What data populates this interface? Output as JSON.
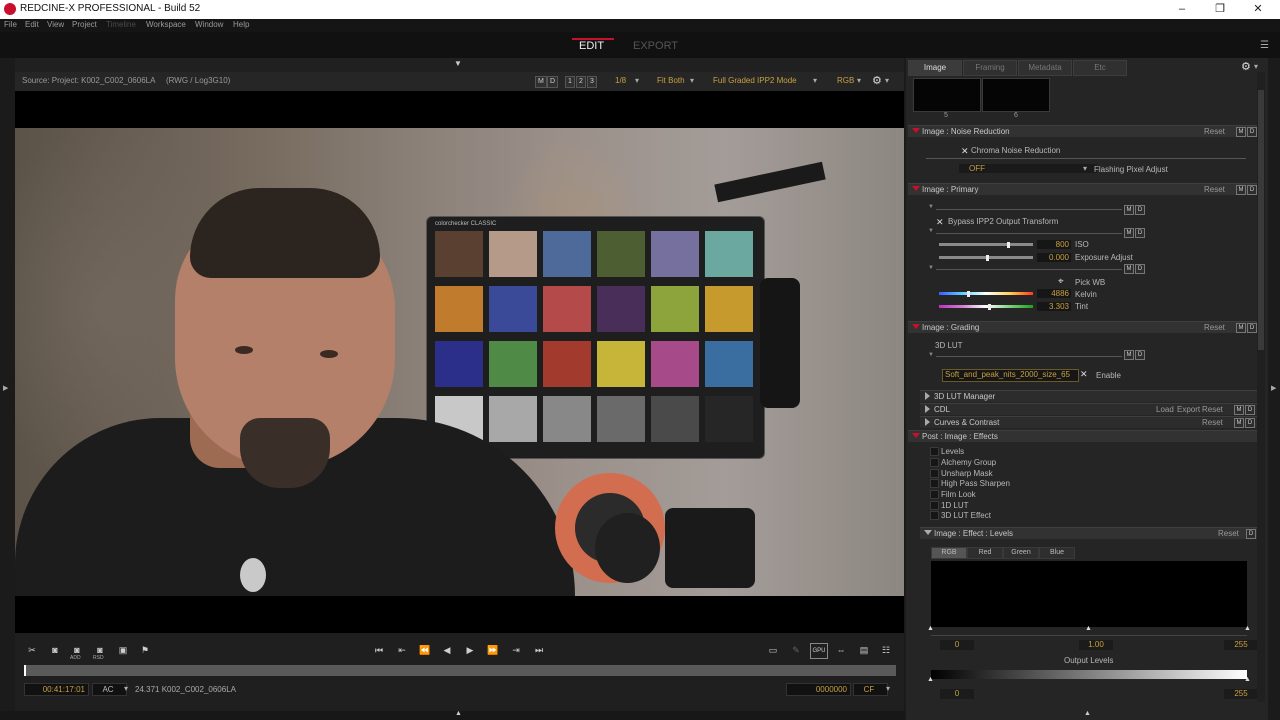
{
  "window": {
    "title": "REDCINE-X PROFESSIONAL - Build 52",
    "minimize": "–",
    "maximize": "❐",
    "close": "✕"
  },
  "menu": [
    {
      "label": "File",
      "enabled": true
    },
    {
      "label": "Edit",
      "enabled": true
    },
    {
      "label": "View",
      "enabled": true
    },
    {
      "label": "Project",
      "enabled": true
    },
    {
      "label": "Timeline",
      "enabled": false
    },
    {
      "label": "Workspace",
      "enabled": true
    },
    {
      "label": "Window",
      "enabled": true
    },
    {
      "label": "Help",
      "enabled": true
    }
  ],
  "modes": {
    "edit": "EDIT",
    "export": "EXPORT"
  },
  "viewer": {
    "source_label": "Source: Project: K002_C002_0606LA",
    "format_label": "(RWG / Log3G10)",
    "m": "M",
    "d": "D",
    "b1": "1",
    "b2": "2",
    "b3": "3",
    "res": "1/8",
    "fit": "Fit Both",
    "mode": "Full Graded IPP2 Mode",
    "channel": "RGB",
    "checker_label": "colorchecker CLASSIC",
    "checker_colors": [
      "#5a4030",
      "#b59a8a",
      "#4d6a9a",
      "#4d5f32",
      "#76709e",
      "#6aa8a0",
      "#c17b2c",
      "#3b4a98",
      "#b44a4a",
      "#4a2e5a",
      "#8da43c",
      "#c79a2e",
      "#2b2f8a",
      "#4f8a46",
      "#a33a2e",
      "#c7b53a",
      "#a64a8a",
      "#3a6ea0",
      "#c8c8c8",
      "#a8a8a8",
      "#888888",
      "#6a6a6a",
      "#4a4a4a",
      "#262626"
    ]
  },
  "transport": {
    "timecode": "00:41:17:01",
    "tc_mode": "AC",
    "clip_info": "24.371 K002_C002_0606LA",
    "frame": "0000000",
    "frame_mode": "CF",
    "add_label": "ADD",
    "rsd_label": "RSD"
  },
  "panel": {
    "tabs": [
      "Image",
      "Framing",
      "Metadata",
      "Etc"
    ],
    "thumbs": [
      "5",
      "6"
    ],
    "reset": "Reset",
    "m": "M",
    "d": "D",
    "noise": {
      "title": "Image : Noise Reduction",
      "chroma": "Chroma Noise Reduction",
      "flash_value": "OFF",
      "flash_label": "Flashing Pixel Adjust"
    },
    "primary": {
      "title": "Image : Primary",
      "bypass": "Bypass IPP2 Output Transform",
      "iso_value": "800",
      "iso_label": "ISO",
      "iso_pos": 0.72,
      "exp_value": "0.000",
      "exp_label": "Exposure Adjust",
      "exp_pos": 0.5,
      "pickwb": "Pick WB",
      "kelvin_value": "4886",
      "kelvin_label": "Kelvin",
      "kelvin_pos": 0.3,
      "tint_value": "3.303",
      "tint_label": "Tint",
      "tint_pos": 0.52
    },
    "grading": {
      "title": "Image : Grading",
      "lut3d": "3D LUT",
      "lut_file": "Soft_and_peak_nits_2000_size_65",
      "enable": "Enable",
      "lut_manager": "3D LUT Manager",
      "cdl": "CDL",
      "load": "Load",
      "export": "Export",
      "curves": "Curves & Contrast"
    },
    "effects": {
      "title": "Post : Image : Effects",
      "items": [
        "Levels",
        "Alchemy Group",
        "Unsharp Mask",
        "High Pass Sharpen",
        "Film Look",
        "1D LUT",
        "3D LUT Effect"
      ]
    },
    "levels": {
      "title": "Image : Effect : Levels",
      "channels": [
        "RGB",
        "Red",
        "Green",
        "Blue"
      ],
      "in_black": "0",
      "gamma": "1.00",
      "in_white": "255",
      "output_label": "Output Levels",
      "out_black": "0",
      "out_white": "255"
    }
  }
}
